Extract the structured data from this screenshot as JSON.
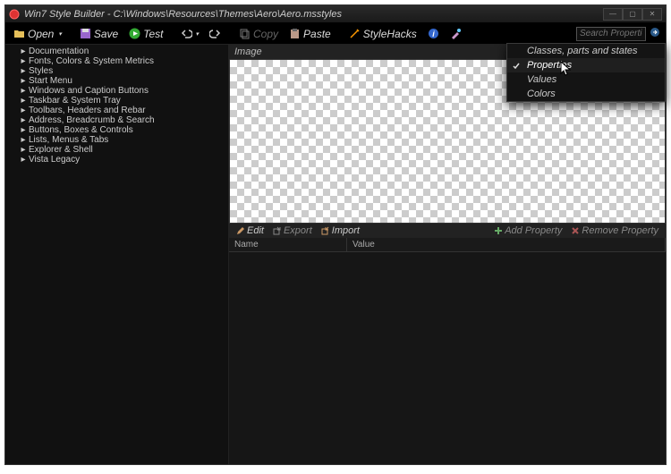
{
  "titlebar": {
    "app": "Win7 Style Builder",
    "path": "C:\\Windows\\Resources\\Themes\\Aero\\Aero.msstyles"
  },
  "toolbar": {
    "open": "Open",
    "save": "Save",
    "test": "Test",
    "copy": "Copy",
    "paste": "Paste",
    "stylehacks": "StyleHacks"
  },
  "search": {
    "placeholder": "Search Properties"
  },
  "sidebar": {
    "items": [
      "Documentation",
      "Fonts, Colors & System Metrics",
      "Styles",
      "Start Menu",
      "Windows and Caption Buttons",
      "Taskbar & System Tray",
      "Toolbars, Headers and Rebar",
      "Address, Breadcrumb & Search",
      "Buttons, Boxes & Controls",
      "Lists, Menus & Tabs",
      "Explorer & Shell",
      "Vista Legacy"
    ]
  },
  "imagepanel": {
    "title": "Image"
  },
  "proptoolbar": {
    "edit": "Edit",
    "export": "Export",
    "import": "Import",
    "add": "Add Property",
    "remove": "Remove Property"
  },
  "propheaders": {
    "name": "Name",
    "value": "Value"
  },
  "contextmenu": {
    "items": [
      "Classes, parts and states",
      "Properties",
      "Values",
      "Colors"
    ],
    "checked_index": 1
  }
}
